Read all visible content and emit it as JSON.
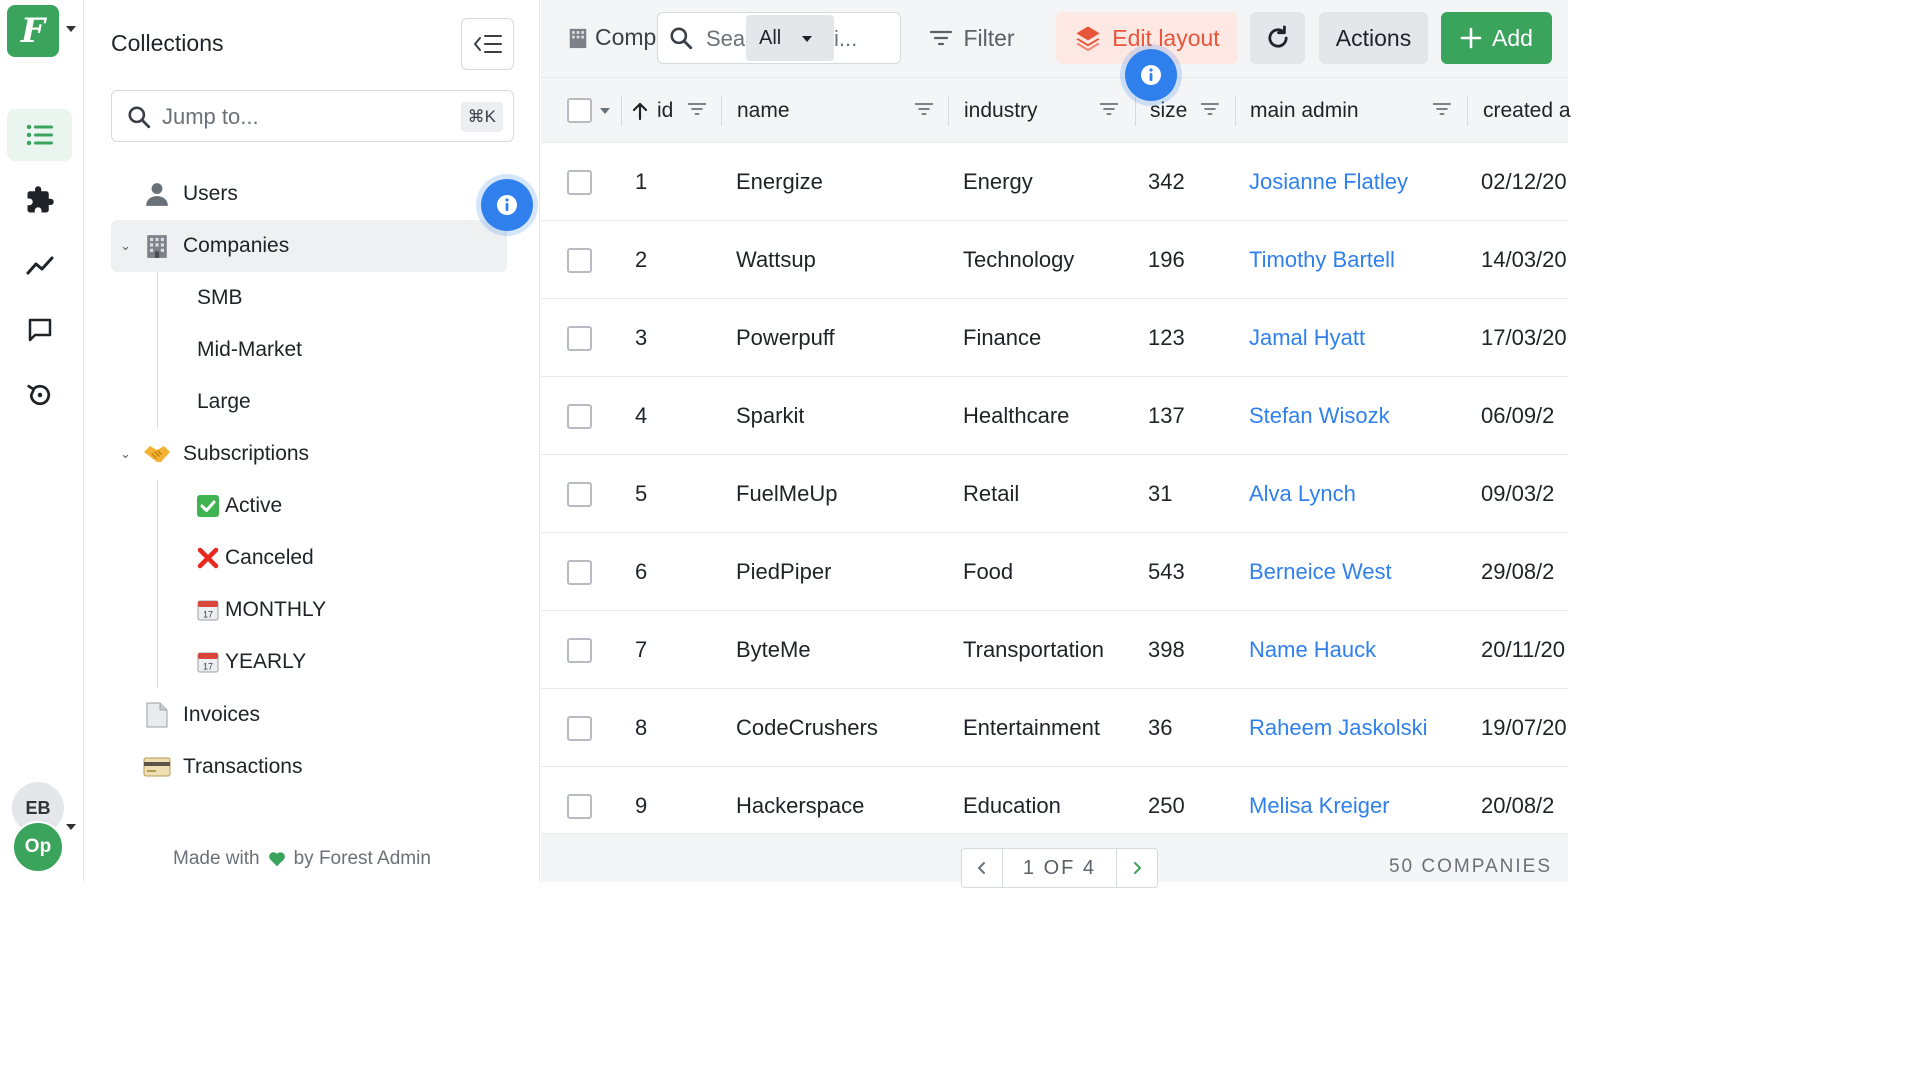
{
  "rail": {
    "logo_letter": "F",
    "items": [
      {
        "icon": "list-icon",
        "active": true
      },
      {
        "icon": "puzzle-icon",
        "active": false
      },
      {
        "icon": "chart-line-icon",
        "active": false
      },
      {
        "icon": "chat-bubble-icon",
        "active": false
      },
      {
        "icon": "history-icon",
        "active": false
      }
    ],
    "user_initials": "EB",
    "project_initials": "Op"
  },
  "sidebar": {
    "title": "Collections",
    "jump_placeholder": "Jump to...",
    "jump_shortcut": "⌘K",
    "items": [
      {
        "label": "Users",
        "emoji": "👤"
      },
      {
        "label": "Companies",
        "emoji": "🏢",
        "selected": true,
        "segments": [
          "SMB",
          "Mid-Market",
          "Large"
        ]
      },
      {
        "label": "Subscriptions",
        "emoji": "🤝",
        "segments": [
          "Active",
          "Canceled",
          "MONTHLY",
          "YEARLY"
        ]
      },
      {
        "label": "Invoices",
        "emoji": "📄"
      },
      {
        "label": "Transactions",
        "emoji": "💳"
      }
    ],
    "subscription_segment_emoji": [
      "✅",
      "❌",
      "📅",
      "📅"
    ],
    "footer_prefix": "Made with",
    "footer_suffix": "by Forest Admin"
  },
  "toolbar": {
    "collection_label": "Comp",
    "search_prefix": "Sea",
    "search_scope": "All",
    "search_suffix": "i...",
    "filter_label": "Filter",
    "edit_layout_label": "Edit layout",
    "actions_label": "Actions",
    "add_label": "Add"
  },
  "table": {
    "columns": [
      "id",
      "name",
      "industry",
      "size",
      "main admin",
      "created a"
    ],
    "rows": [
      {
        "id": "1",
        "name": "Energize",
        "industry": "Energy",
        "size": "342",
        "main_admin": "Josianne Flatley",
        "created": "02/12/20"
      },
      {
        "id": "2",
        "name": "Wattsup",
        "industry": "Technology",
        "size": "196",
        "main_admin": "Timothy Bartell",
        "created": "14/03/20"
      },
      {
        "id": "3",
        "name": "Powerpuff",
        "industry": "Finance",
        "size": "123",
        "main_admin": "Jamal Hyatt",
        "created": "17/03/20"
      },
      {
        "id": "4",
        "name": "Sparkit",
        "industry": "Healthcare",
        "size": "137",
        "main_admin": "Stefan Wisozk",
        "created": "06/09/2"
      },
      {
        "id": "5",
        "name": "FuelMeUp",
        "industry": "Retail",
        "size": "31",
        "main_admin": "Alva Lynch",
        "created": "09/03/2"
      },
      {
        "id": "6",
        "name": "PiedPiper",
        "industry": "Food",
        "size": "543",
        "main_admin": "Berneice West",
        "created": "29/08/2"
      },
      {
        "id": "7",
        "name": "ByteMe",
        "industry": "Transportation",
        "size": "398",
        "main_admin": "Name Hauck",
        "created": "20/11/20"
      },
      {
        "id": "8",
        "name": "CodeCrushers",
        "industry": "Entertainment",
        "size": "36",
        "main_admin": "Raheem Jaskolski",
        "created": "19/07/20"
      },
      {
        "id": "9",
        "name": "Hackerspace",
        "industry": "Education",
        "size": "250",
        "main_admin": "Melisa Kreiger",
        "created": "20/08/2"
      }
    ]
  },
  "pagination": {
    "label": "1 OF 4",
    "total": "50 COMPANIES"
  },
  "colors": {
    "brand": "#3aa35c",
    "link": "#2f80ed",
    "edit_layout": "#e8553a",
    "info_badge": "#2f80ed"
  }
}
